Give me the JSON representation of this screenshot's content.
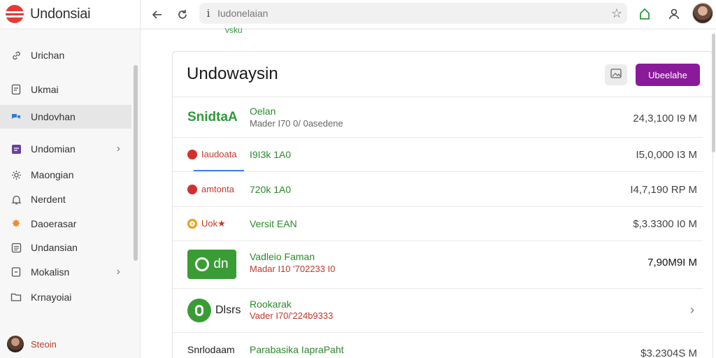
{
  "app": {
    "name": "Undonsiai"
  },
  "toolbar": {
    "url": "Iudonelaian",
    "subtitle": "vsku"
  },
  "sidebar": {
    "items": [
      {
        "label": "Urichan",
        "icon": "link-icon"
      },
      {
        "label": "Ukmai",
        "icon": "document-icon"
      },
      {
        "label": "Undovhan",
        "icon": "chat-icon",
        "active": true
      },
      {
        "label": "Undomian",
        "icon": "inbox-icon",
        "chevron": true
      },
      {
        "label": "Maongian",
        "icon": "settings-icon"
      },
      {
        "label": "Nerdent",
        "icon": "bell-icon"
      },
      {
        "label": "Daoerasar",
        "icon": "star-icon"
      },
      {
        "label": "Undansian",
        "icon": "list-icon"
      },
      {
        "label": "Mokalisn",
        "icon": "box-icon",
        "chevron": true
      },
      {
        "label": "Krnayoiai",
        "icon": "folder-icon"
      }
    ],
    "user": {
      "name": "Steoin"
    }
  },
  "panel": {
    "title": "Undowaysin",
    "primary_button": "Ubeelahe",
    "rows": [
      {
        "logo": "SnidtaA",
        "main": "Oelan",
        "sub": "Mader I70 0/ 0asedene",
        "value": "24,3,100 I9 M"
      },
      {
        "logo": "Iaudoata",
        "main": "I9I3k 1A0",
        "value": "I5,0,000 I3 M"
      },
      {
        "logo": "amtonta",
        "main": "720k 1A0",
        "value": "I4,7,190 RP M"
      },
      {
        "logo": "Uok★",
        "main": "Versit EAN",
        "value": "$,3.3300 I0 M"
      },
      {
        "logo": "dn",
        "main": "Vadleio Faman",
        "sub": "Madar I10 '702233 I0",
        "value": "7,90M9I M"
      },
      {
        "logo": "Dlsrs",
        "main": "Rookarak",
        "sub": "Vader I70/'224b9333"
      },
      {
        "logo": "Snrlodaam",
        "main": "Parabasika IapraPaht",
        "value": "$3.2304S M"
      }
    ]
  },
  "colors": {
    "accent": "#8b1a9a",
    "green": "#2e9a3a",
    "brand_red": "#e53935"
  }
}
